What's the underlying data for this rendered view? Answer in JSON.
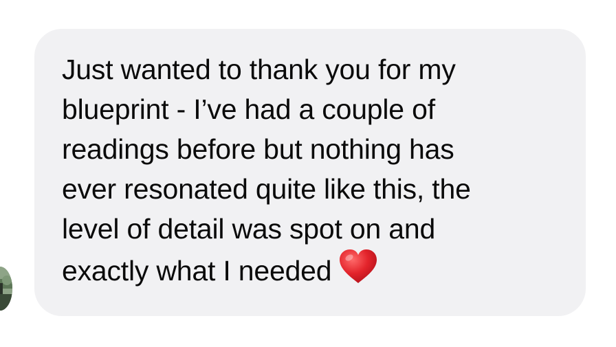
{
  "message": {
    "lines": [
      "Just wanted to thank you for my",
      "blueprint - I’ve had a couple of",
      "readings before but nothing has",
      "ever resonated quite like this, the",
      "level of detail was spot on and",
      "exactly what I needed"
    ],
    "emoji": "red-heart",
    "bubble_color": "#f1f1f3",
    "text_color": "#0a0a0a",
    "heart_color": "#e3242b"
  },
  "sender": {
    "avatar_icon": "profile-photo"
  }
}
